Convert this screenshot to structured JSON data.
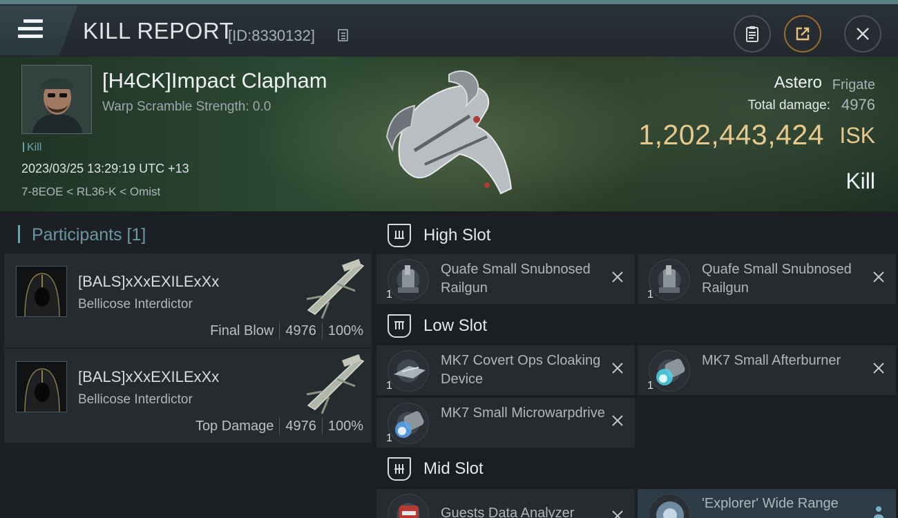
{
  "header": {
    "title": "KILL REPORT",
    "kill_id": "[ID:8330132]"
  },
  "victim": {
    "name": "[H4CK]Impact Clapham",
    "warp_scramble": "Warp Scramble Strength: 0.0",
    "tag": "Kill",
    "datetime": "2023/03/25 13:29:19 UTC +13",
    "location": "7-8EOE < RL36-K < Omist",
    "ship_name": "Astero",
    "ship_class": "Frigate",
    "total_damage_label": "Total damage:",
    "total_damage": "4976",
    "isk_value": "1,202,443,424",
    "isk_unit": "ISK",
    "result": "Kill"
  },
  "participants": {
    "heading": "Participants",
    "count": "[1]",
    "items": [
      {
        "name": "[BALS]xXxEXILExXx",
        "ship": "Bellicose Interdictor",
        "role": "Final Blow",
        "damage": "4976",
        "percent": "100%"
      },
      {
        "name": "[BALS]xXxEXILExXx",
        "ship": "Bellicose Interdictor",
        "role": "Top Damage",
        "damage": "4976",
        "percent": "100%"
      }
    ]
  },
  "fitting": {
    "high_slot": {
      "label": "High Slot",
      "modules": [
        {
          "name": "Quafe Small Snubnosed Railgun",
          "qty": "1",
          "icon": "railgun-icon"
        },
        {
          "name": "Quafe Small Snubnosed Railgun",
          "qty": "1",
          "icon": "railgun-icon"
        }
      ]
    },
    "low_slot": {
      "label": "Low Slot",
      "modules": [
        {
          "name": "MK7 Covert Ops Cloaking Device",
          "qty": "1",
          "icon": "cloak-icon"
        },
        {
          "name": "MK7 Small Afterburner",
          "qty": "1",
          "icon": "afterburner-icon"
        },
        {
          "name": "MK7 Small Microwarpdrive",
          "qty": "1",
          "icon": "microwarpdrive-icon"
        }
      ]
    },
    "mid_slot": {
      "label": "Mid Slot",
      "modules": [
        {
          "name": "Guests Data Analyzer",
          "qty": "",
          "icon": "data-analyzer-icon"
        },
        {
          "name": "'Explorer' Wide Range",
          "qty": "",
          "icon": "scanner-icon"
        }
      ]
    }
  },
  "colors": {
    "accent": "#6fa3ad",
    "isk": "#e7c98e",
    "panel": "#262b30"
  }
}
